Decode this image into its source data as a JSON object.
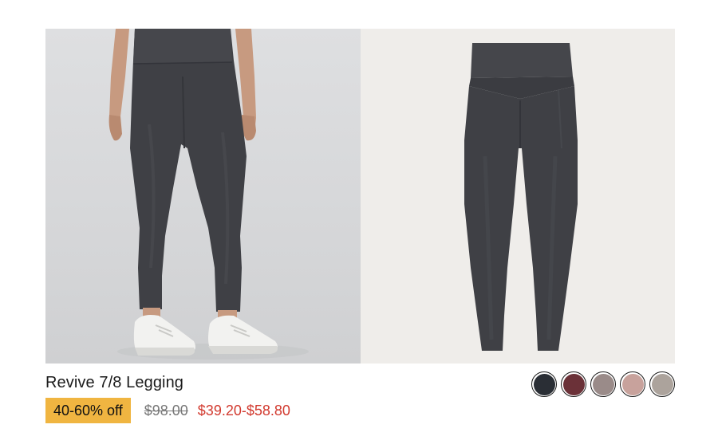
{
  "product": {
    "title": "Revive 7/8 Legging",
    "discount_badge": "40-60% off",
    "original_price": "$98.00",
    "sale_price": "$39.20-$58.80"
  },
  "images": [
    {
      "name": "model-wearing-legging"
    },
    {
      "name": "legging-flat-product"
    }
  ],
  "swatches": [
    {
      "name": "navy",
      "color": "#2a2e35"
    },
    {
      "name": "burgundy",
      "color": "#6b3138"
    },
    {
      "name": "taupe",
      "color": "#9a8b89"
    },
    {
      "name": "blush",
      "color": "#c8a29c"
    },
    {
      "name": "stone",
      "color": "#aca39c"
    }
  ],
  "colors": {
    "badge_bg": "#f0b541",
    "sale_price": "#d23a2f",
    "legging": "#3f4045"
  }
}
